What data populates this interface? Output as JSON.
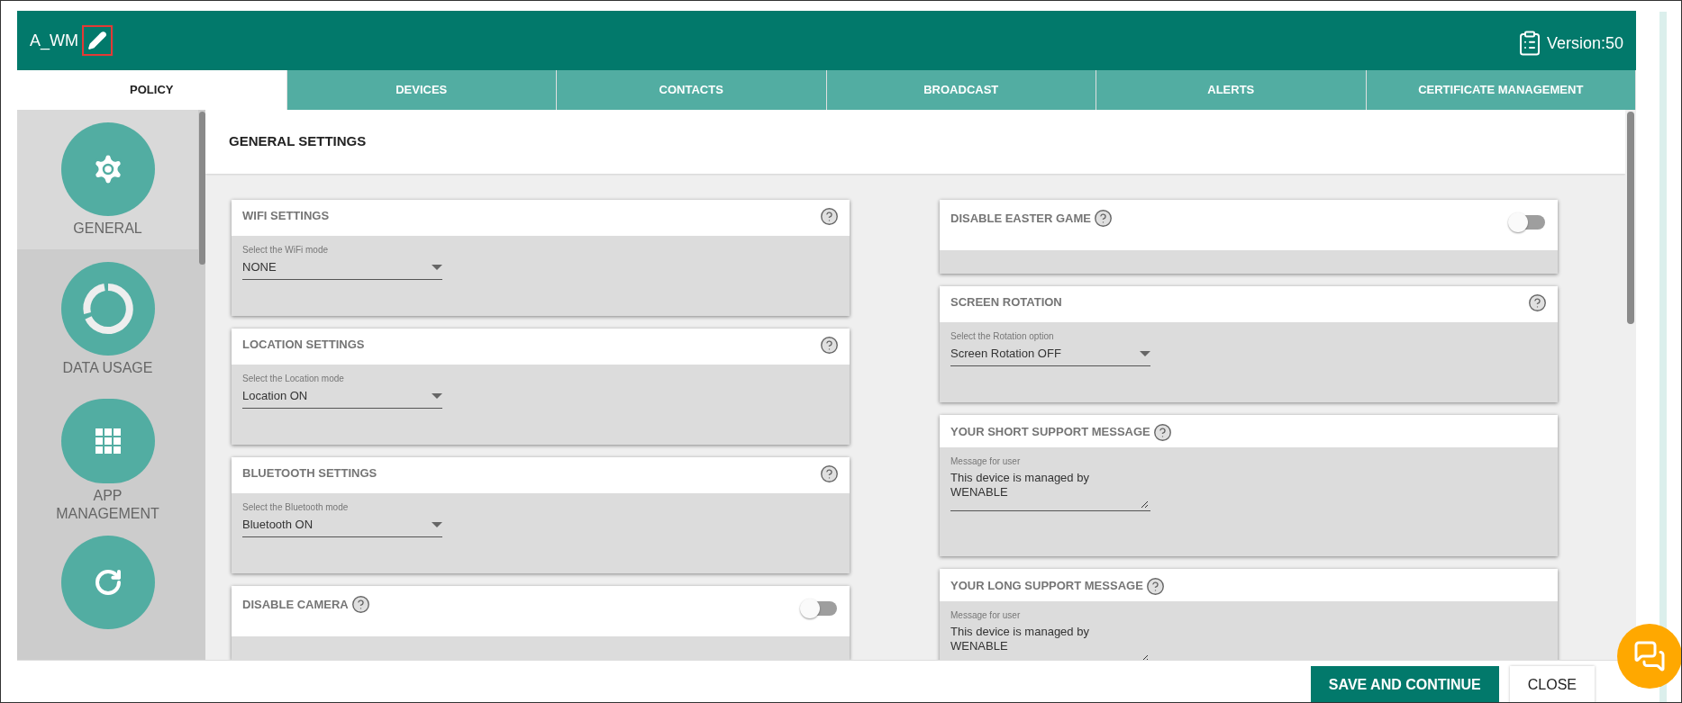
{
  "header": {
    "title": "A_WM",
    "version": "Version:50"
  },
  "tabs": [
    {
      "label": "POLICY",
      "selected": true
    },
    {
      "label": "DEVICES",
      "selected": false
    },
    {
      "label": "CONTACTS",
      "selected": false
    },
    {
      "label": "BROADCAST",
      "selected": false
    },
    {
      "label": "ALERTS",
      "selected": false
    },
    {
      "label": "CERTIFICATE MANAGEMENT",
      "selected": false
    }
  ],
  "sidebar": {
    "items": [
      {
        "kind": "gear",
        "label": "GENERAL",
        "selected": true
      },
      {
        "kind": "ring",
        "label": "DATA USAGE",
        "selected": false
      },
      {
        "kind": "grid",
        "label": "APP MANAGEMENT",
        "selected": false
      },
      {
        "kind": "refresh",
        "selected": false
      }
    ]
  },
  "section_title": "GENERAL SETTINGS",
  "columns": [
    [
      {
        "kind": "select",
        "title": "WIFI SETTINGS",
        "field_label": "Select the WiFi mode",
        "value": "NONE"
      },
      {
        "kind": "select",
        "title": "LOCATION SETTINGS",
        "field_label": "Select the Location mode",
        "value": "Location ON"
      },
      {
        "kind": "select",
        "title": "BLUETOOTH SETTINGS",
        "field_label": "Select the Bluetooth mode",
        "value": "Bluetooth ON"
      },
      {
        "kind": "toggle",
        "title": "DISABLE CAMERA",
        "on": false
      }
    ],
    [
      {
        "kind": "toggle",
        "title": "DISABLE EASTER GAME",
        "on": false
      },
      {
        "kind": "select",
        "title": "SCREEN ROTATION",
        "field_label": "Select the Rotation option",
        "value": "Screen Rotation OFF"
      },
      {
        "kind": "textarea",
        "title": "YOUR SHORT SUPPORT MESSAGE",
        "field_label": "Message for user",
        "value": "This device is managed by\nWENABLE"
      },
      {
        "kind": "textarea",
        "title": "YOUR LONG SUPPORT MESSAGE",
        "field_label": "Message for user",
        "value": "This device is managed by\nWENABLE"
      }
    ]
  ],
  "footer": {
    "buttons": [
      {
        "kind": "primary",
        "label": "SAVE AND CONTINUE"
      },
      {
        "kind": "secondary",
        "label": "CLOSE"
      }
    ]
  }
}
